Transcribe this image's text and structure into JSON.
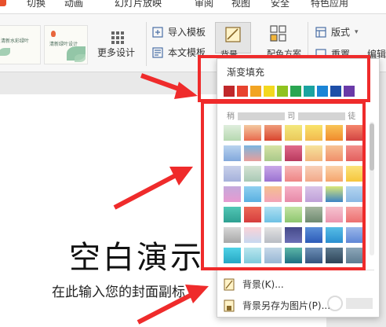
{
  "menu": {
    "tabs": [
      "切换",
      "动画",
      "幻灯片放映",
      "审阅",
      "视图",
      "安全",
      "特色应用"
    ]
  },
  "ribbon": {
    "design_more_label": "更多设计",
    "thumb1_text": "清新水彩绿叶",
    "thumb2_text": "清新绿叶设计",
    "import_template_label": "导入模板",
    "text_template_label": "本文模板",
    "background_label": "背景",
    "color_scheme_label": "配色方案",
    "layout_label": "版式",
    "reset_label": "重置",
    "edit_label": "编辑"
  },
  "slide": {
    "title": "空白演示",
    "subtitle": "在此输入您的封面副标"
  },
  "popup": {
    "gradient_fill_title": "渐变填充",
    "pattern_label_left": "稍",
    "pattern_label_mid": "司",
    "pattern_label_right": "徒",
    "solid_colors": [
      "#c0282b",
      "#e8432f",
      "#f2a423",
      "#f3d81e",
      "#8fc31f",
      "#2aa651",
      "#1aa3a0",
      "#1b85d6",
      "#1e4fa8",
      "#6a3aa8"
    ],
    "gradients": [
      [
        "#dfeedd",
        "#b6d8b0"
      ],
      [
        "#f4c9a0",
        "#e86a4d"
      ],
      [
        "#ef9c7a",
        "#d9452e"
      ],
      [
        "#f4e87d",
        "#eac95b"
      ],
      [
        "#f9e36a",
        "#f3b94e"
      ],
      [
        "#f9c456",
        "#f08a2d"
      ],
      [
        "#f5866b",
        "#d24442"
      ],
      [
        "#b9d3ef",
        "#82a8dc"
      ],
      [
        "#7bb6e0",
        "#e89e9a"
      ],
      [
        "#d6e3a5",
        "#a9c98a"
      ],
      [
        "#e06a8b",
        "#b93a5e"
      ],
      [
        "#f6e39c",
        "#f2b67c"
      ],
      [
        "#f7c293",
        "#f08f6b"
      ],
      [
        "#f28f8a",
        "#e3605e"
      ],
      [
        "#c9d1ea",
        "#a5b1db"
      ],
      [
        "#d5e3d3",
        "#a9c9b5"
      ],
      [
        "#c9a7e8",
        "#9b73d1"
      ],
      [
        "#f7b6b6",
        "#ee8585"
      ],
      [
        "#f8d0b8",
        "#f2a98a"
      ],
      [
        "#fbd2a9",
        "#f5a56d"
      ],
      [
        "#fbe37b",
        "#f6c63c"
      ],
      [
        "#c4a9dc",
        "#e79ad0"
      ],
      [
        "#8fd0f0",
        "#5ab0e1"
      ],
      [
        "#f5c08f",
        "#f3a3b7"
      ],
      [
        "#f6b0c6",
        "#e78aa8"
      ],
      [
        "#d9c4e8",
        "#bfa0d8"
      ],
      [
        "#d9e879",
        "#3c84c4"
      ],
      [
        "#b4d5f0",
        "#8ab8e4"
      ],
      [
        "#52c7b5",
        "#2ea092"
      ],
      [
        "#ec6a58",
        "#d63d3d"
      ],
      [
        "#aee0f2",
        "#6ec1e4"
      ],
      [
        "#c3e3a3",
        "#8dc66f"
      ],
      [
        "#a6b7a0",
        "#6e8a70"
      ],
      [
        "#f6c3d0",
        "#eb95ad"
      ],
      [
        "#f7a3a3",
        "#ec6f6f"
      ],
      [
        "#d7d7d7",
        "#a8a8a8"
      ],
      [
        "#fbd2d7",
        "#c7d8f0"
      ],
      [
        "#e3e3e3",
        "#b8bcc4"
      ],
      [
        "#454a8a",
        "#6b6fb5"
      ],
      [
        "#5a8fd8",
        "#2d5bb8"
      ],
      [
        "#57bde6",
        "#2a8fcf"
      ],
      [
        "#9ab7ea",
        "#5f86d6"
      ],
      [
        "#4fd2e6",
        "#26a7c4"
      ],
      [
        "#b9e6ee",
        "#7fcadb"
      ],
      [
        "#c6d8e9",
        "#98b7d4"
      ],
      [
        "#5cb7a7",
        "#1e6f82"
      ],
      [
        "#6d8fb7",
        "#35557e"
      ],
      [
        "#5c7a8f",
        "#2e4458"
      ],
      [
        "#8ca6b8",
        "#5e7d92"
      ]
    ],
    "background_item_label": "背景(K)...",
    "save_background_label": "背景另存为图片(P)..."
  },
  "annotations": {
    "box_color": "#ef2b2b"
  }
}
